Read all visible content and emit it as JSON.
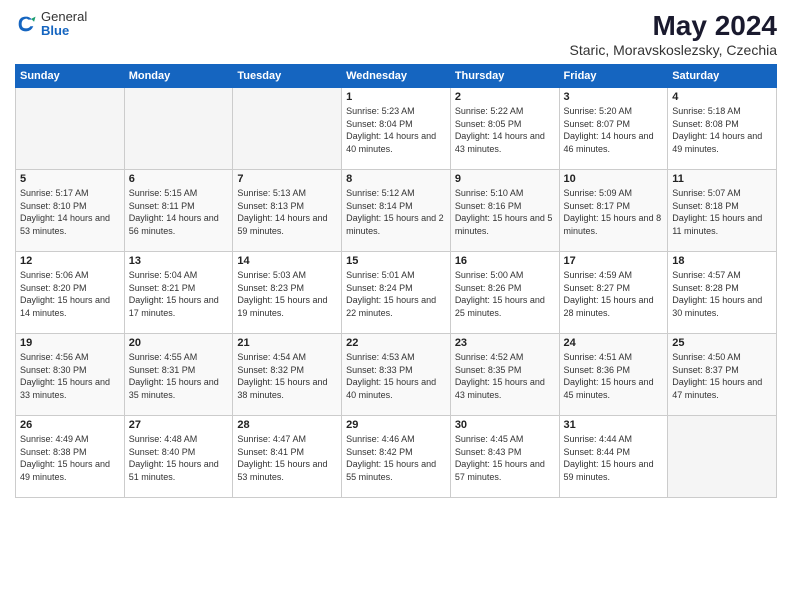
{
  "logo": {
    "general": "General",
    "blue": "Blue"
  },
  "title": "May 2024",
  "location": "Staric, Moravskoslezsky, Czechia",
  "days_of_week": [
    "Sunday",
    "Monday",
    "Tuesday",
    "Wednesday",
    "Thursday",
    "Friday",
    "Saturday"
  ],
  "weeks": [
    [
      {
        "day": "",
        "empty": true
      },
      {
        "day": "",
        "empty": true
      },
      {
        "day": "",
        "empty": true
      },
      {
        "day": "1",
        "sunrise": "5:23 AM",
        "sunset": "8:04 PM",
        "daylight": "14 hours and 40 minutes."
      },
      {
        "day": "2",
        "sunrise": "5:22 AM",
        "sunset": "8:05 PM",
        "daylight": "14 hours and 43 minutes."
      },
      {
        "day": "3",
        "sunrise": "5:20 AM",
        "sunset": "8:07 PM",
        "daylight": "14 hours and 46 minutes."
      },
      {
        "day": "4",
        "sunrise": "5:18 AM",
        "sunset": "8:08 PM",
        "daylight": "14 hours and 49 minutes."
      }
    ],
    [
      {
        "day": "5",
        "sunrise": "5:17 AM",
        "sunset": "8:10 PM",
        "daylight": "14 hours and 53 minutes."
      },
      {
        "day": "6",
        "sunrise": "5:15 AM",
        "sunset": "8:11 PM",
        "daylight": "14 hours and 56 minutes."
      },
      {
        "day": "7",
        "sunrise": "5:13 AM",
        "sunset": "8:13 PM",
        "daylight": "14 hours and 59 minutes."
      },
      {
        "day": "8",
        "sunrise": "5:12 AM",
        "sunset": "8:14 PM",
        "daylight": "15 hours and 2 minutes."
      },
      {
        "day": "9",
        "sunrise": "5:10 AM",
        "sunset": "8:16 PM",
        "daylight": "15 hours and 5 minutes."
      },
      {
        "day": "10",
        "sunrise": "5:09 AM",
        "sunset": "8:17 PM",
        "daylight": "15 hours and 8 minutes."
      },
      {
        "day": "11",
        "sunrise": "5:07 AM",
        "sunset": "8:18 PM",
        "daylight": "15 hours and 11 minutes."
      }
    ],
    [
      {
        "day": "12",
        "sunrise": "5:06 AM",
        "sunset": "8:20 PM",
        "daylight": "15 hours and 14 minutes."
      },
      {
        "day": "13",
        "sunrise": "5:04 AM",
        "sunset": "8:21 PM",
        "daylight": "15 hours and 17 minutes."
      },
      {
        "day": "14",
        "sunrise": "5:03 AM",
        "sunset": "8:23 PM",
        "daylight": "15 hours and 19 minutes."
      },
      {
        "day": "15",
        "sunrise": "5:01 AM",
        "sunset": "8:24 PM",
        "daylight": "15 hours and 22 minutes."
      },
      {
        "day": "16",
        "sunrise": "5:00 AM",
        "sunset": "8:26 PM",
        "daylight": "15 hours and 25 minutes."
      },
      {
        "day": "17",
        "sunrise": "4:59 AM",
        "sunset": "8:27 PM",
        "daylight": "15 hours and 28 minutes."
      },
      {
        "day": "18",
        "sunrise": "4:57 AM",
        "sunset": "8:28 PM",
        "daylight": "15 hours and 30 minutes."
      }
    ],
    [
      {
        "day": "19",
        "sunrise": "4:56 AM",
        "sunset": "8:30 PM",
        "daylight": "15 hours and 33 minutes."
      },
      {
        "day": "20",
        "sunrise": "4:55 AM",
        "sunset": "8:31 PM",
        "daylight": "15 hours and 35 minutes."
      },
      {
        "day": "21",
        "sunrise": "4:54 AM",
        "sunset": "8:32 PM",
        "daylight": "15 hours and 38 minutes."
      },
      {
        "day": "22",
        "sunrise": "4:53 AM",
        "sunset": "8:33 PM",
        "daylight": "15 hours and 40 minutes."
      },
      {
        "day": "23",
        "sunrise": "4:52 AM",
        "sunset": "8:35 PM",
        "daylight": "15 hours and 43 minutes."
      },
      {
        "day": "24",
        "sunrise": "4:51 AM",
        "sunset": "8:36 PM",
        "daylight": "15 hours and 45 minutes."
      },
      {
        "day": "25",
        "sunrise": "4:50 AM",
        "sunset": "8:37 PM",
        "daylight": "15 hours and 47 minutes."
      }
    ],
    [
      {
        "day": "26",
        "sunrise": "4:49 AM",
        "sunset": "8:38 PM",
        "daylight": "15 hours and 49 minutes."
      },
      {
        "day": "27",
        "sunrise": "4:48 AM",
        "sunset": "8:40 PM",
        "daylight": "15 hours and 51 minutes."
      },
      {
        "day": "28",
        "sunrise": "4:47 AM",
        "sunset": "8:41 PM",
        "daylight": "15 hours and 53 minutes."
      },
      {
        "day": "29",
        "sunrise": "4:46 AM",
        "sunset": "8:42 PM",
        "daylight": "15 hours and 55 minutes."
      },
      {
        "day": "30",
        "sunrise": "4:45 AM",
        "sunset": "8:43 PM",
        "daylight": "15 hours and 57 minutes."
      },
      {
        "day": "31",
        "sunrise": "4:44 AM",
        "sunset": "8:44 PM",
        "daylight": "15 hours and 59 minutes."
      },
      {
        "day": "",
        "empty": true
      }
    ]
  ]
}
